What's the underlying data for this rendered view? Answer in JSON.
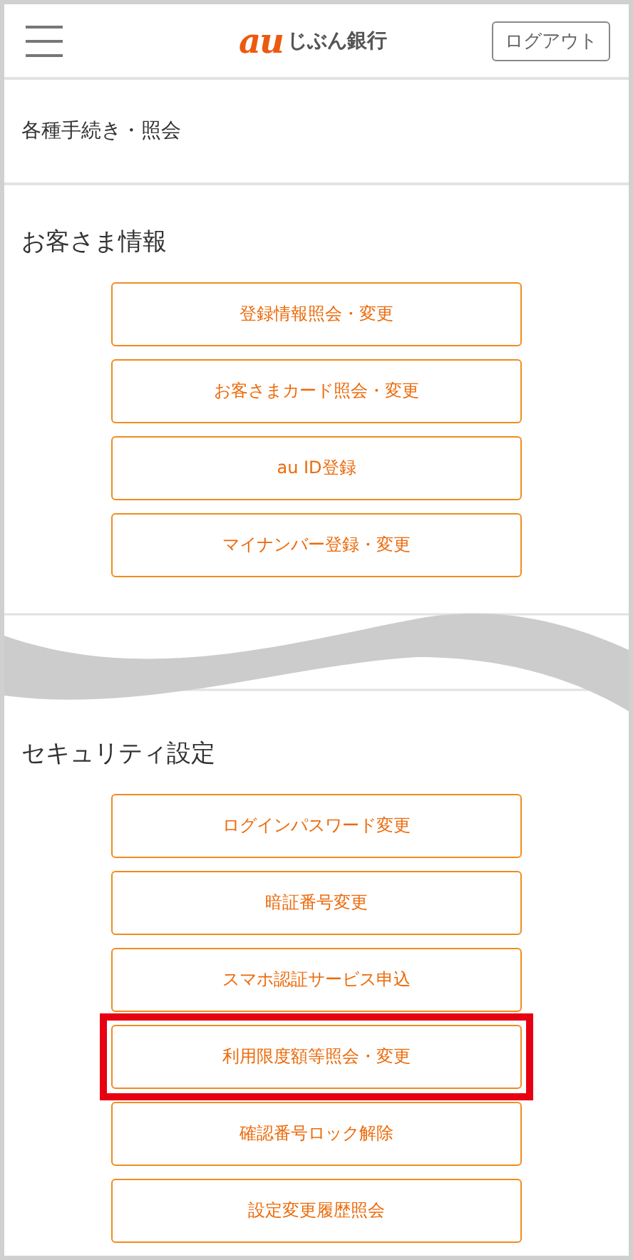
{
  "header": {
    "logo_mark": "au",
    "logo_text": "じぶん銀行",
    "logout": "ログアウト"
  },
  "page_title": "各種手続き・照会",
  "sections": [
    {
      "title": "お客さま情報",
      "buttons": [
        {
          "label": "登録情報照会・変更",
          "highlighted": false
        },
        {
          "label": "お客さまカード照会・変更",
          "highlighted": false
        },
        {
          "label": "au ID登録",
          "highlighted": false
        },
        {
          "label": "マイナンバー登録・変更",
          "highlighted": false
        }
      ]
    },
    {
      "title": "セキュリティ設定",
      "buttons": [
        {
          "label": "ログインパスワード変更",
          "highlighted": false
        },
        {
          "label": "暗証番号変更",
          "highlighted": false
        },
        {
          "label": "スマホ認証サービス申込",
          "highlighted": false
        },
        {
          "label": "利用限度額等照会・変更",
          "highlighted": true
        },
        {
          "label": "確認番号ロック解除",
          "highlighted": false
        },
        {
          "label": "設定変更履歴照会",
          "highlighted": false
        }
      ]
    }
  ]
}
